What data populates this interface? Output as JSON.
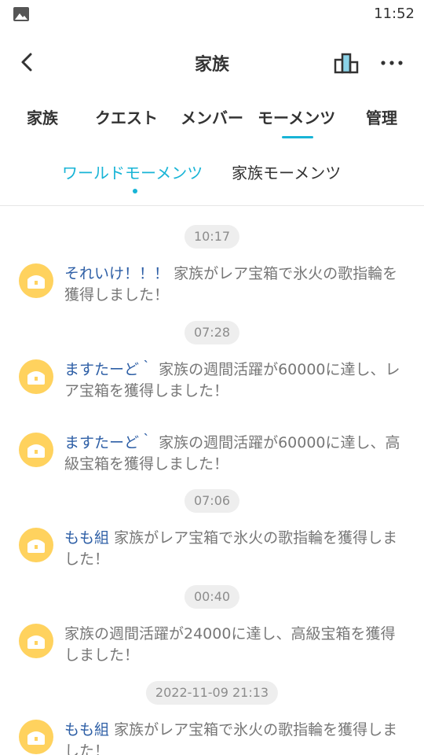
{
  "status": {
    "time": "11:52",
    "photo_icon": "image-icon"
  },
  "header": {
    "title": "家族",
    "back_icon": "chevron-left-icon",
    "ranking_icon": "ranking-podium-icon",
    "more_icon": "more-dots-icon"
  },
  "tabs": [
    {
      "label": "家族"
    },
    {
      "label": "クエスト"
    },
    {
      "label": "メンバー"
    },
    {
      "label": "モーメンツ",
      "active": true
    },
    {
      "label": "管理"
    }
  ],
  "subtabs": [
    {
      "label": "ワールドモーメンツ",
      "active": true
    },
    {
      "label": "家族モーメンツ"
    }
  ],
  "feed": [
    {
      "type": "time",
      "text": "10:17"
    },
    {
      "type": "item",
      "name": "それいけ！！！",
      "text": "家族がレア宝箱で氷火の歌指輪を獲得しました！"
    },
    {
      "type": "time",
      "text": "07:28"
    },
    {
      "type": "item",
      "name": "ますたーど｀",
      "text": "家族の週間活躍が60000に達し、レア宝箱を獲得しました！"
    },
    {
      "type": "item",
      "name": "ますたーど｀",
      "text": "家族の週間活躍が60000に達し、高級宝箱を獲得しました！"
    },
    {
      "type": "time",
      "text": "07:06"
    },
    {
      "type": "item",
      "name": "もも組",
      "text": "家族がレア宝箱で氷火の歌指輪を獲得しました！"
    },
    {
      "type": "time",
      "text": "00:40"
    },
    {
      "type": "item",
      "name": "",
      "text": "家族の週間活躍が24000に達し、高級宝箱を獲得しました！"
    },
    {
      "type": "time",
      "text": "2022-11-09 21:13"
    },
    {
      "type": "item",
      "name": "もも組",
      "text": "家族がレア宝箱で氷火の歌指輪を獲得しました！"
    }
  ],
  "colors": {
    "accent": "#18b4d6",
    "chest_bg": "#ffd25e",
    "name_link": "#2e5fa6"
  }
}
